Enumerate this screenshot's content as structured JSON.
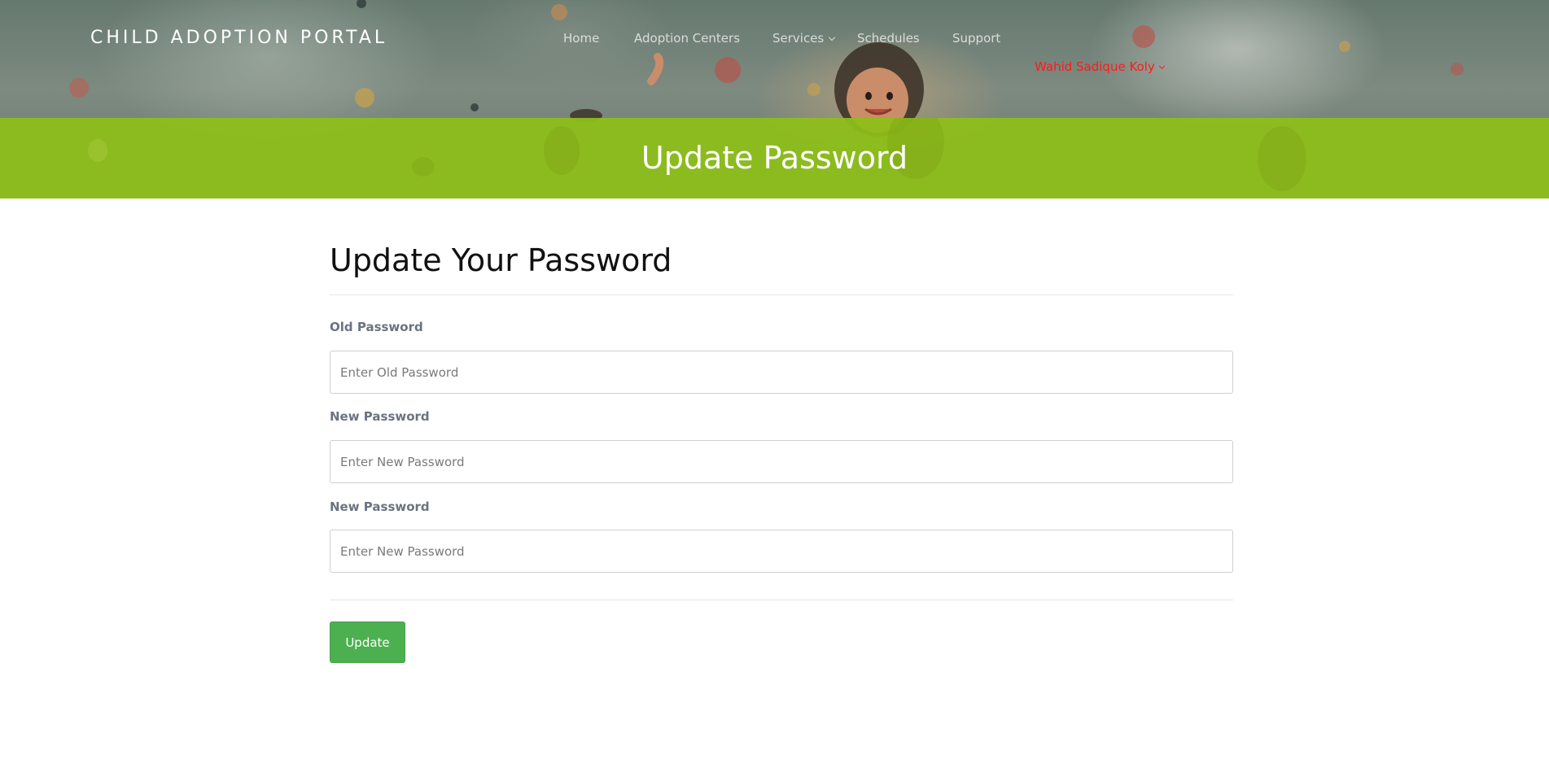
{
  "header": {
    "brand": "CHILD ADOPTION PORTAL",
    "nav": [
      {
        "label": "Home"
      },
      {
        "label": "Adoption Centers"
      },
      {
        "label": "Services"
      },
      {
        "label": "Schedules"
      },
      {
        "label": "Support"
      }
    ],
    "user_name": "Wahid Sadique Koly",
    "page_title": "Update Password"
  },
  "form": {
    "heading": "Update Your Password",
    "fields": [
      {
        "label": "Old Password",
        "placeholder": "Enter Old Password",
        "value": ""
      },
      {
        "label": "New Password",
        "placeholder": "Enter New Password",
        "value": ""
      },
      {
        "label": "New Password",
        "placeholder": "Enter New Password",
        "value": ""
      }
    ],
    "submit_label": "Update"
  },
  "colors": {
    "title_band": "#8ebf19",
    "user_menu": "#ff1a1a",
    "submit_button": "#4cb050"
  },
  "icons": {
    "services_dropdown": "chevron-down-icon",
    "user_dropdown": "chevron-down-icon"
  }
}
